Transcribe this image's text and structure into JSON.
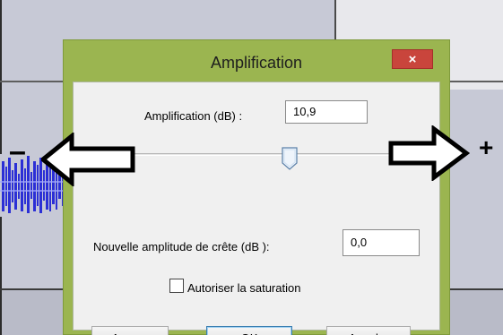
{
  "dialog": {
    "title": "Amplification",
    "close_glyph": "×",
    "amplification_label": "Amplification (dB) :",
    "amplification_value": "10,9",
    "peak_label": "Nouvelle amplitude de crête (dB ):",
    "peak_value": "0,0",
    "allow_clipping_label": "Autoriser la saturation",
    "allow_clipping_checked": false,
    "slider_level_fraction": 0.63,
    "buttons": {
      "preview": "Aperçu",
      "ok": "OK",
      "cancel": "Annuler"
    }
  },
  "overlay": {
    "minus": "–",
    "plus": "+"
  },
  "colors": {
    "title_bar": "#9bb550",
    "close_button": "#c9453c",
    "client_bg": "#f0f0f0",
    "waveform": "#2b2fd6",
    "background": "#c7c9d6"
  },
  "icons": [
    "close-icon",
    "slider-thumb-icon",
    "left-arrow-icon",
    "right-arrow-icon",
    "checkbox-icon"
  ]
}
